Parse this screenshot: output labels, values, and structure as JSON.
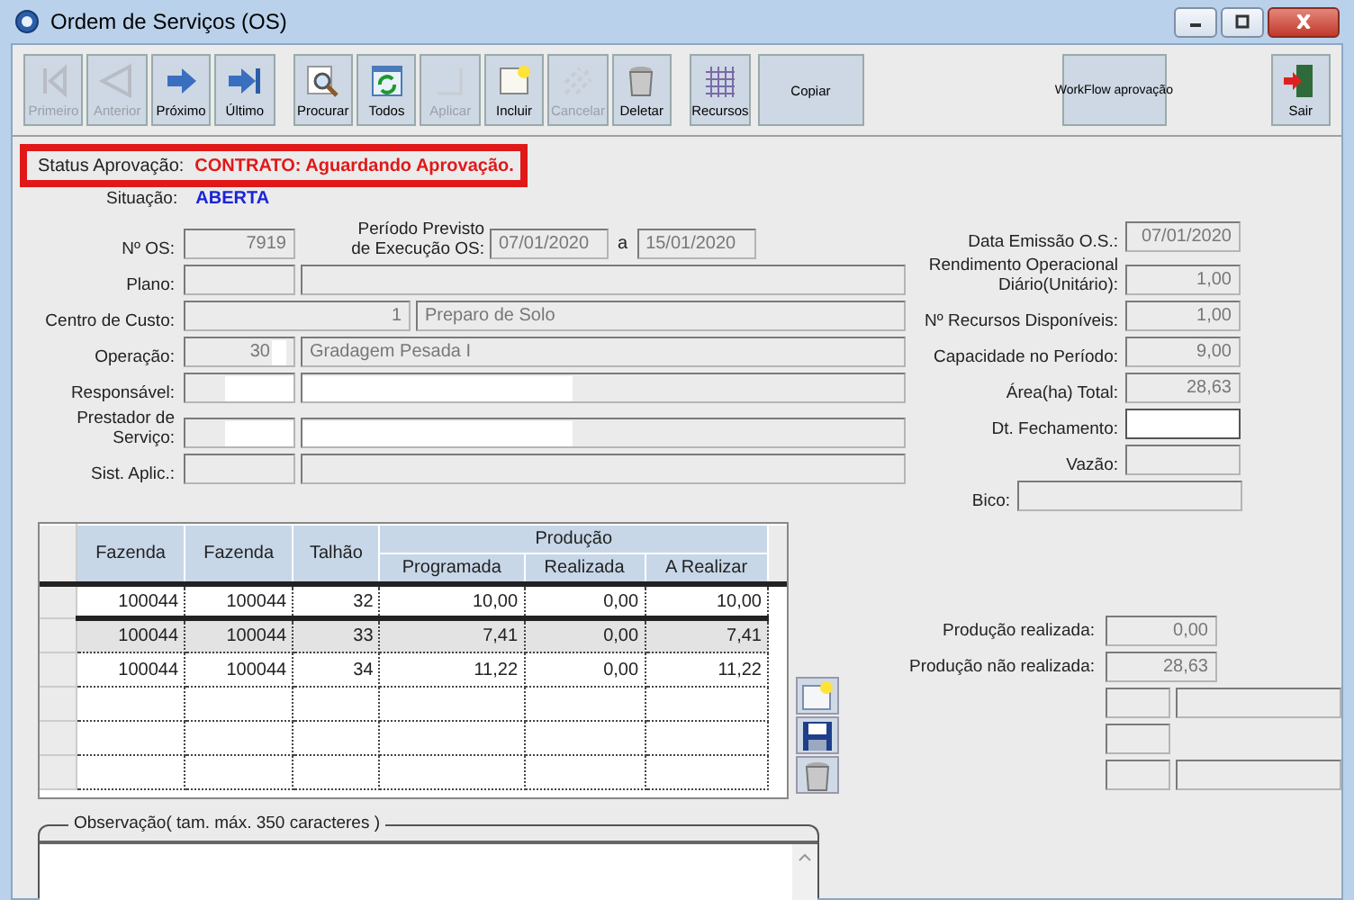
{
  "window": {
    "title": "Ordem de Serviços (OS)"
  },
  "toolbar": [
    {
      "label": "Primeiro",
      "kind": "first",
      "disabled": true
    },
    {
      "label": "Anterior",
      "kind": "prev",
      "disabled": true
    },
    {
      "label": "Próximo",
      "kind": "next",
      "disabled": false
    },
    {
      "label": "Último",
      "kind": "last",
      "disabled": false
    },
    {
      "label": "Procurar",
      "kind": "search",
      "disabled": false
    },
    {
      "label": "Todos",
      "kind": "refresh",
      "disabled": false
    },
    {
      "label": "Aplicar",
      "kind": "blank",
      "disabled": true
    },
    {
      "label": "Incluir",
      "kind": "new",
      "disabled": false
    },
    {
      "label": "Cancelar",
      "kind": "cancel",
      "disabled": true
    },
    {
      "label": "Deletar",
      "kind": "trash",
      "disabled": false
    },
    {
      "label": "Recursos",
      "kind": "grid",
      "disabled": false
    },
    {
      "label": "Copiar",
      "kind": "text",
      "disabled": false
    },
    {
      "label": "WorkFlow aprovação",
      "kind": "text",
      "disabled": false
    },
    {
      "label": "Sair",
      "kind": "exit",
      "disabled": false
    }
  ],
  "status": {
    "label": "Status Aprovação:",
    "value": "CONTRATO: Aguardando Aprovação."
  },
  "situacao": {
    "label": "Situação:",
    "value": "ABERTA"
  },
  "os": {
    "label": "Nº OS:",
    "value": "7919"
  },
  "periodo": {
    "label": "Período Previsto de Execução OS:",
    "start": "07/01/2020",
    "separator": "a",
    "end": "15/01/2020"
  },
  "left_fields": [
    {
      "label": "Plano:",
      "kind": "pair",
      "redacted": false
    },
    {
      "label": "Centro de Custo:",
      "kind": "wide",
      "code": "1",
      "description": "Preparo de Solo",
      "redacted": false
    },
    {
      "label": "Operação:",
      "kind": "pair",
      "code": "30",
      "description": "Gradagem Pesada I",
      "redacted": true
    },
    {
      "label": "Responsável:",
      "kind": "pair",
      "redacted": true
    },
    {
      "label": "Prestador de Serviço:",
      "kind": "pair",
      "redacted": true
    },
    {
      "label": "Sist. Aplic.:",
      "kind": "pair",
      "redacted": false
    }
  ],
  "right_fields": [
    {
      "label": "Data Emissão O.S.:",
      "value": "07/01/2020",
      "editable": false,
      "kind": "normal"
    },
    {
      "label": "Rendimento Operacional Diário(Unitário):",
      "value": "1,00",
      "editable": false,
      "kind": "normal"
    },
    {
      "label": "Nº Recursos Disponíveis:",
      "value": "1,00",
      "editable": false,
      "kind": "normal"
    },
    {
      "label": "Capacidade no Período:",
      "value": "9,00",
      "editable": false,
      "kind": "normal"
    },
    {
      "label": "Área(ha) Total:",
      "value": "28,63",
      "editable": false,
      "kind": "normal"
    },
    {
      "label": "Dt. Fechamento:",
      "editable": true,
      "kind": "normal"
    },
    {
      "label": "Vazão:",
      "editable": false,
      "kind": "normal"
    },
    {
      "label": "Bico:",
      "editable": false,
      "kind": "wide"
    }
  ],
  "table": {
    "columns": [
      "Fazenda",
      "Fazenda",
      "Talhão"
    ],
    "group": {
      "label": "Produção",
      "columns": [
        "Programada",
        "Realizada",
        "A Realizar"
      ]
    },
    "rows": [
      {
        "cells": [
          "100044",
          "100044",
          "32",
          "10,00",
          "0,00",
          "10,00"
        ],
        "selected": false
      },
      {
        "cells": [
          "100044",
          "100044",
          "33",
          "7,41",
          "0,00",
          "7,41"
        ],
        "selected": true
      },
      {
        "cells": [
          "100044",
          "100044",
          "34",
          "11,22",
          "0,00",
          "11,22"
        ],
        "selected": false
      }
    ]
  },
  "production": [
    {
      "label": "Produção realizada:",
      "value": "0,00"
    },
    {
      "label": "Produção não realizada:",
      "value": "28,63"
    }
  ],
  "observacao": {
    "label": "Observação( tam. máx. 350 caracteres )"
  }
}
